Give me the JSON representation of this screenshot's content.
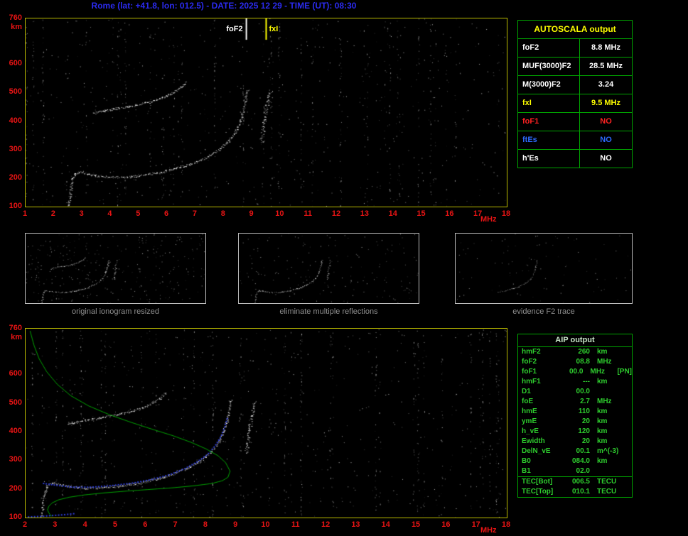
{
  "header": {
    "title": "Rome (lat: +41.8, lon: 012.5) - DATE: 2025 12 29 - TIME (UT): 08:30"
  },
  "colors": {
    "background": "#000000",
    "header_text": "#2b2bf0",
    "axis_labels": "#e81414",
    "plot_border": "#b9b900",
    "table_border": "#00a500",
    "autoscala_title": "#ffff00",
    "aip_text": "#2ecc2e",
    "trace_white": "#ffffff",
    "profile_green": "#00b400",
    "fit_blue": "#3344ee",
    "caption_gray": "#8f8f8f"
  },
  "autoscala_table": {
    "title": "AUTOSCALA output",
    "rows": [
      {
        "label": "foF2",
        "value": "8.8 MHz",
        "color": "#ffffff"
      },
      {
        "label": "MUF(3000)F2",
        "value": "28.5 MHz",
        "color": "#ffffff"
      },
      {
        "label": "M(3000)F2",
        "value": "3.24",
        "color": "#ffffff"
      },
      {
        "label": "fxI",
        "value": "9.5 MHz",
        "color": "#ffff00"
      },
      {
        "label": "foF1",
        "value": "NO",
        "color": "#ff2222"
      },
      {
        "label": "ftEs",
        "value": "NO",
        "color": "#2e6bff"
      },
      {
        "label": "h'Es",
        "value": "NO",
        "color": "#ffffff"
      }
    ]
  },
  "aip_table": {
    "title": "AIP output",
    "rows": [
      {
        "label": "hmF2",
        "value": "260",
        "unit": "km",
        "extra": ""
      },
      {
        "label": "foF2",
        "value": "08.8",
        "unit": "MHz",
        "extra": ""
      },
      {
        "label": "foF1",
        "value": "00.0",
        "unit": "MHz",
        "extra": "[PN]"
      },
      {
        "label": "hmF1",
        "value": "---",
        "unit": "km",
        "extra": ""
      },
      {
        "label": "D1",
        "value": "00.0",
        "unit": "",
        "extra": ""
      },
      {
        "label": "foE",
        "value": "2.7",
        "unit": "MHz",
        "extra": ""
      },
      {
        "label": "hmE",
        "value": "110",
        "unit": "km",
        "extra": ""
      },
      {
        "label": "ymE",
        "value": "20",
        "unit": "km",
        "extra": ""
      },
      {
        "label": "h_vE",
        "value": "120",
        "unit": "km",
        "extra": ""
      },
      {
        "label": "Ewidth",
        "value": "20",
        "unit": "km",
        "extra": ""
      },
      {
        "label": "DelN_vE",
        "value": "00.1",
        "unit": "m^(-3)",
        "extra": ""
      },
      {
        "label": "B0",
        "value": "084.0",
        "unit": "km",
        "extra": ""
      },
      {
        "label": "B1",
        "value": "02.0",
        "unit": "",
        "extra": ""
      },
      {
        "label": "TEC[Bot]",
        "value": "006.5",
        "unit": "TECU",
        "extra": "",
        "sep": true
      },
      {
        "label": "TEC[Top]",
        "value": "010.1",
        "unit": "TECU",
        "extra": ""
      }
    ]
  },
  "thumbnails": [
    {
      "caption": "original ionogram resized",
      "show": [
        {
          "name": "low-freq-cusp"
        },
        {
          "name": "F2-trace"
        },
        {
          "name": "second-hop-trace"
        },
        {
          "name": "x-mode-spread"
        }
      ],
      "speckles": 300
    },
    {
      "caption": "eliminate multiple reflections",
      "show": [
        {
          "name": "low-freq-cusp"
        },
        {
          "name": "F2-trace"
        },
        {
          "name": "x-mode-spread",
          "alpha": 0.8
        }
      ],
      "speckles": 170
    },
    {
      "caption": "evidence F2 trace",
      "show": [
        {
          "name": "F2-trace",
          "from": 5.0,
          "alpha": 0.75
        }
      ],
      "speckles": 90
    }
  ],
  "chart_data": [
    {
      "type": "scatter",
      "name": "autoscala-ionogram",
      "xlabel": "MHz",
      "ylabel": "km",
      "xlim": [
        1,
        18
      ],
      "ylim": [
        100,
        760
      ],
      "xticks": [
        1,
        2,
        3,
        4,
        5,
        6,
        7,
        8,
        9,
        10,
        11,
        12,
        13,
        14,
        15,
        16,
        17,
        18
      ],
      "yticks": [
        760,
        600,
        500,
        400,
        300,
        200,
        100
      ],
      "markers": [
        {
          "label": "foF2",
          "x": 8.8,
          "color": "#ffffff"
        },
        {
          "label": "fxI",
          "x": 9.5,
          "color": "#ffff00",
          "align": "right"
        }
      ],
      "noise": {
        "seed": 11,
        "speckles": 520,
        "stripes": 42
      },
      "series": [
        {
          "name": "low-freq-cusp",
          "color": "#ffffff",
          "points": [
            [
              2.5,
              105
            ],
            [
              2.55,
              128
            ],
            [
              2.58,
              152
            ],
            [
              2.62,
              178
            ],
            [
              2.66,
              200
            ],
            [
              2.75,
              216
            ],
            [
              2.9,
              222
            ]
          ]
        },
        {
          "name": "F2-trace",
          "color": "#ffffff",
          "points": [
            [
              2.9,
              222
            ],
            [
              3.3,
              211
            ],
            [
              3.9,
              204
            ],
            [
              4.5,
              204
            ],
            [
              5.1,
              210
            ],
            [
              5.7,
              220
            ],
            [
              6.3,
              234
            ],
            [
              6.9,
              252
            ],
            [
              7.4,
              274
            ],
            [
              7.8,
              298
            ],
            [
              8.1,
              324
            ],
            [
              8.35,
              353
            ],
            [
              8.5,
              383
            ],
            [
              8.62,
              416
            ],
            [
              8.72,
              452
            ],
            [
              8.78,
              484
            ],
            [
              8.82,
              508
            ]
          ]
        },
        {
          "name": "second-hop-trace",
          "color": "#ffffff",
          "points": [
            [
              3.4,
              428
            ],
            [
              3.9,
              439
            ],
            [
              4.4,
              448
            ],
            [
              4.9,
              457
            ],
            [
              5.4,
              468
            ],
            [
              5.8,
              481
            ],
            [
              6.15,
              497
            ],
            [
              6.45,
              516
            ],
            [
              6.65,
              536
            ]
          ]
        },
        {
          "name": "x-mode-spread",
          "color": "#ffffff",
          "jitter": 2.5,
          "points": [
            [
              9.32,
              330
            ],
            [
              9.38,
              365
            ],
            [
              9.43,
              400
            ],
            [
              9.47,
              432
            ],
            [
              9.52,
              462
            ],
            [
              9.57,
              488
            ],
            [
              9.62,
              505
            ]
          ]
        }
      ]
    },
    {
      "type": "scatter",
      "name": "aip-ionogram-with-profile",
      "xlabel": "MHz",
      "ylabel": "km",
      "xlim": [
        2,
        18
      ],
      "ylim": [
        100,
        760
      ],
      "xticks": [
        2,
        3,
        4,
        5,
        6,
        7,
        8,
        9,
        10,
        11,
        12,
        13,
        14,
        15,
        16,
        17,
        18
      ],
      "yticks": [
        760,
        600,
        500,
        400,
        300,
        200,
        100
      ],
      "markers": [],
      "noise": {
        "seed": 23,
        "speckles": 520,
        "stripes": 40
      },
      "series": [
        {
          "name": "low-freq-cusp",
          "color": "#ffffff",
          "points": [
            [
              2.5,
              105
            ],
            [
              2.55,
              128
            ],
            [
              2.58,
              152
            ],
            [
              2.62,
              178
            ],
            [
              2.66,
              200
            ],
            [
              2.75,
              216
            ],
            [
              2.9,
              222
            ]
          ]
        },
        {
          "name": "F2-trace",
          "color": "#ffffff",
          "points": [
            [
              2.9,
              222
            ],
            [
              3.3,
              211
            ],
            [
              3.9,
              204
            ],
            [
              4.5,
              204
            ],
            [
              5.1,
              210
            ],
            [
              5.7,
              220
            ],
            [
              6.3,
              234
            ],
            [
              6.9,
              252
            ],
            [
              7.4,
              274
            ],
            [
              7.8,
              298
            ],
            [
              8.1,
              324
            ],
            [
              8.35,
              353
            ],
            [
              8.5,
              383
            ],
            [
              8.62,
              416
            ],
            [
              8.72,
              452
            ],
            [
              8.78,
              484
            ],
            [
              8.82,
              508
            ]
          ]
        },
        {
          "name": "second-hop-trace",
          "color": "#ffffff",
          "points": [
            [
              3.4,
              428
            ],
            [
              3.9,
              439
            ],
            [
              4.4,
              448
            ],
            [
              4.9,
              457
            ],
            [
              5.4,
              468
            ],
            [
              5.8,
              481
            ],
            [
              6.15,
              497
            ],
            [
              6.45,
              516
            ],
            [
              6.65,
              536
            ]
          ]
        },
        {
          "name": "x-mode-spread",
          "color": "#ffffff",
          "jitter": 2.5,
          "points": [
            [
              9.32,
              330
            ],
            [
              9.38,
              365
            ],
            [
              9.43,
              400
            ],
            [
              9.47,
              432
            ],
            [
              9.52,
              462
            ],
            [
              9.57,
              488
            ],
            [
              9.62,
              505
            ]
          ]
        },
        {
          "name": "fitted-trace",
          "color": "#3344ee",
          "style": "squares",
          "points": [
            [
              2.6,
              219
            ],
            [
              3.0,
              213
            ],
            [
              3.6,
              206
            ],
            [
              4.2,
              206
            ],
            [
              4.9,
              212
            ],
            [
              5.6,
              221
            ],
            [
              6.2,
              233
            ],
            [
              6.8,
              250
            ],
            [
              7.3,
              271
            ],
            [
              7.7,
              294
            ],
            [
              8.05,
              320
            ],
            [
              8.3,
              350
            ],
            [
              8.5,
              383
            ],
            [
              8.62,
              416
            ],
            [
              8.72,
              450
            ]
          ]
        },
        {
          "name": "fitted-E-trace",
          "color": "#3344ee",
          "style": "squares",
          "points": [
            [
              2.1,
              102
            ],
            [
              2.5,
              104
            ],
            [
              2.9,
              107
            ],
            [
              3.3,
              110
            ],
            [
              3.65,
              114
            ]
          ]
        },
        {
          "name": "electron-density-profile",
          "color": "#00b400",
          "style": "line",
          "points": [
            [
              2.15,
              752
            ],
            [
              2.28,
              702
            ],
            [
              2.45,
              655
            ],
            [
              2.7,
              610
            ],
            [
              3.05,
              566
            ],
            [
              3.5,
              526
            ],
            [
              4.1,
              490
            ],
            [
              4.8,
              459
            ],
            [
              5.5,
              433
            ],
            [
              6.2,
              409
            ],
            [
              6.9,
              386
            ],
            [
              7.5,
              363
            ],
            [
              8.0,
              340
            ],
            [
              8.4,
              316
            ],
            [
              8.65,
              292
            ],
            [
              8.8,
              262
            ],
            [
              8.73,
              241
            ],
            [
              8.55,
              229
            ],
            [
              8.2,
              219
            ],
            [
              7.6,
              211
            ],
            [
              6.9,
              204
            ],
            [
              6.1,
              198
            ],
            [
              5.3,
              192
            ],
            [
              4.6,
              186
            ],
            [
              3.95,
              179
            ],
            [
              3.45,
              171
            ],
            [
              3.1,
              162
            ],
            [
              2.88,
              151
            ],
            [
              2.77,
              139
            ],
            [
              2.73,
              127
            ],
            [
              2.78,
              115
            ],
            [
              2.87,
              104
            ]
          ]
        }
      ]
    }
  ]
}
